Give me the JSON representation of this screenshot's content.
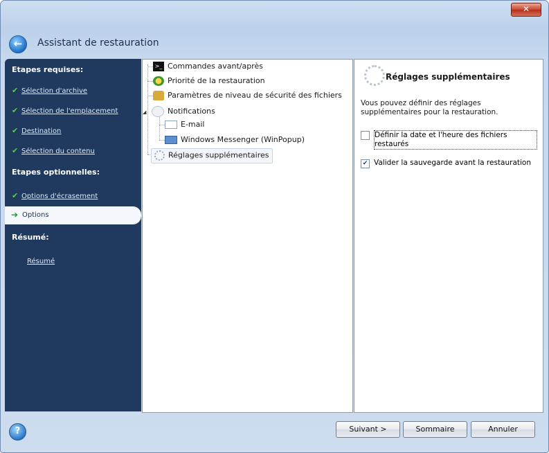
{
  "window": {
    "title": "Assistant de restauration",
    "close_glyph": "✕"
  },
  "sidebar": {
    "required_heading": "Etapes requises:",
    "required_items": [
      {
        "label": "Sélection d'archive"
      },
      {
        "label": "Sélection de l'emplacement"
      },
      {
        "label": "Destination"
      },
      {
        "label": "Sélection du contenu"
      }
    ],
    "optional_heading": "Etapes optionnelles:",
    "optional_items": [
      {
        "label": "Options d'écrasement"
      }
    ],
    "active_item": "Options",
    "summary_heading": "Résumé:",
    "summary_item": "Résumé"
  },
  "tree": {
    "items": [
      {
        "label": "Commandes avant/après",
        "icon": "terminal-icon"
      },
      {
        "label": "Priorité de la restauration",
        "icon": "priority-icon"
      },
      {
        "label": "Paramètres de niveau de sécurité des fichiers",
        "icon": "lock-icon"
      },
      {
        "label": "Notifications",
        "icon": "notification-icon"
      },
      {
        "label": "E-mail",
        "icon": "email-icon"
      },
      {
        "label": "Windows Messenger (WinPopup)",
        "icon": "messenger-icon"
      },
      {
        "label": "Réglages supplémentaires",
        "icon": "gear-icon"
      }
    ]
  },
  "panel": {
    "title": "Réglages supplémentaires",
    "description": "Vous pouvez définir des réglages supplémentaires pour la restauration.",
    "options": [
      {
        "label": "Définir la date et l'heure des fichiers restaurés",
        "checked": false
      },
      {
        "label": "Valider la sauvegarde avant la restauration",
        "checked": true
      }
    ]
  },
  "footer": {
    "next_label": "Suivant >",
    "summary_label": "Sommaire",
    "cancel_label": "Annuler",
    "help_glyph": "?"
  }
}
